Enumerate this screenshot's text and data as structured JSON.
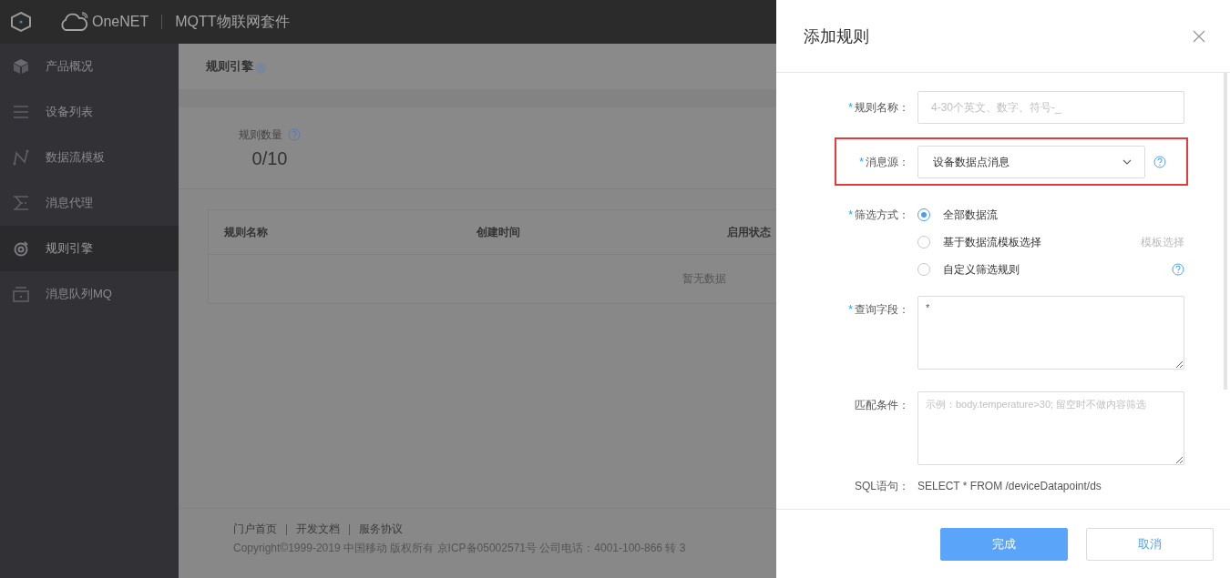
{
  "topbar": {
    "brand": "OneNET",
    "product": "MQTT物联网套件"
  },
  "sidebar": {
    "items": [
      {
        "label": "产品概况",
        "selected": false
      },
      {
        "label": "设备列表",
        "selected": false
      },
      {
        "label": "数据流模板",
        "selected": false
      },
      {
        "label": "消息代理",
        "selected": false
      },
      {
        "label": "规则引擎",
        "selected": true
      },
      {
        "label": "消息队列MQ",
        "selected": false
      }
    ]
  },
  "page": {
    "title": "规则引擎",
    "stat": {
      "label": "规则数量",
      "value": "0/10"
    },
    "table": {
      "columns": [
        "规则名称",
        "创建时间",
        "启用状态"
      ],
      "empty": "暂无数据"
    }
  },
  "footer": {
    "links": [
      "门户首页",
      "开发文档",
      "服务协议"
    ],
    "copyright": "Copyright©1999-2019 中国移动 版权所有 京ICP备05002571号 公司电话：4001-100-866 转 3"
  },
  "drawer": {
    "title": "添加规则",
    "fields": [
      {
        "kind": "input",
        "mark": "*",
        "label": "规则名称：",
        "placeholder": "4-30个英文、数字、符号-_"
      },
      {
        "kind": "select",
        "mark": "*",
        "label": "消息源：",
        "value": "设备数据点消息",
        "highlighted": true,
        "help": true
      },
      {
        "kind": "radio",
        "mark": "*",
        "label": "筛选方式：",
        "options": [
          {
            "label": "全部数据流",
            "selected": true
          },
          {
            "label": "基于数据流模板选择",
            "selected": false,
            "action": "模板选择"
          },
          {
            "label": "自定义筛选规则",
            "selected": false,
            "help": true
          }
        ]
      },
      {
        "kind": "textarea",
        "mark": "*",
        "label": "查询字段：",
        "value": "*"
      },
      {
        "kind": "textarea",
        "label": "匹配条件：",
        "placeholder": "示例：body.temperature>30; 留空时不做内容筛选"
      },
      {
        "kind": "text",
        "label": "SQL语句：",
        "value": "SELECT * FROM /deviceDatapoint/ds"
      }
    ],
    "buttons": [
      {
        "label": "完成",
        "kind": "primary"
      },
      {
        "label": "取消",
        "kind": "default"
      }
    ]
  }
}
